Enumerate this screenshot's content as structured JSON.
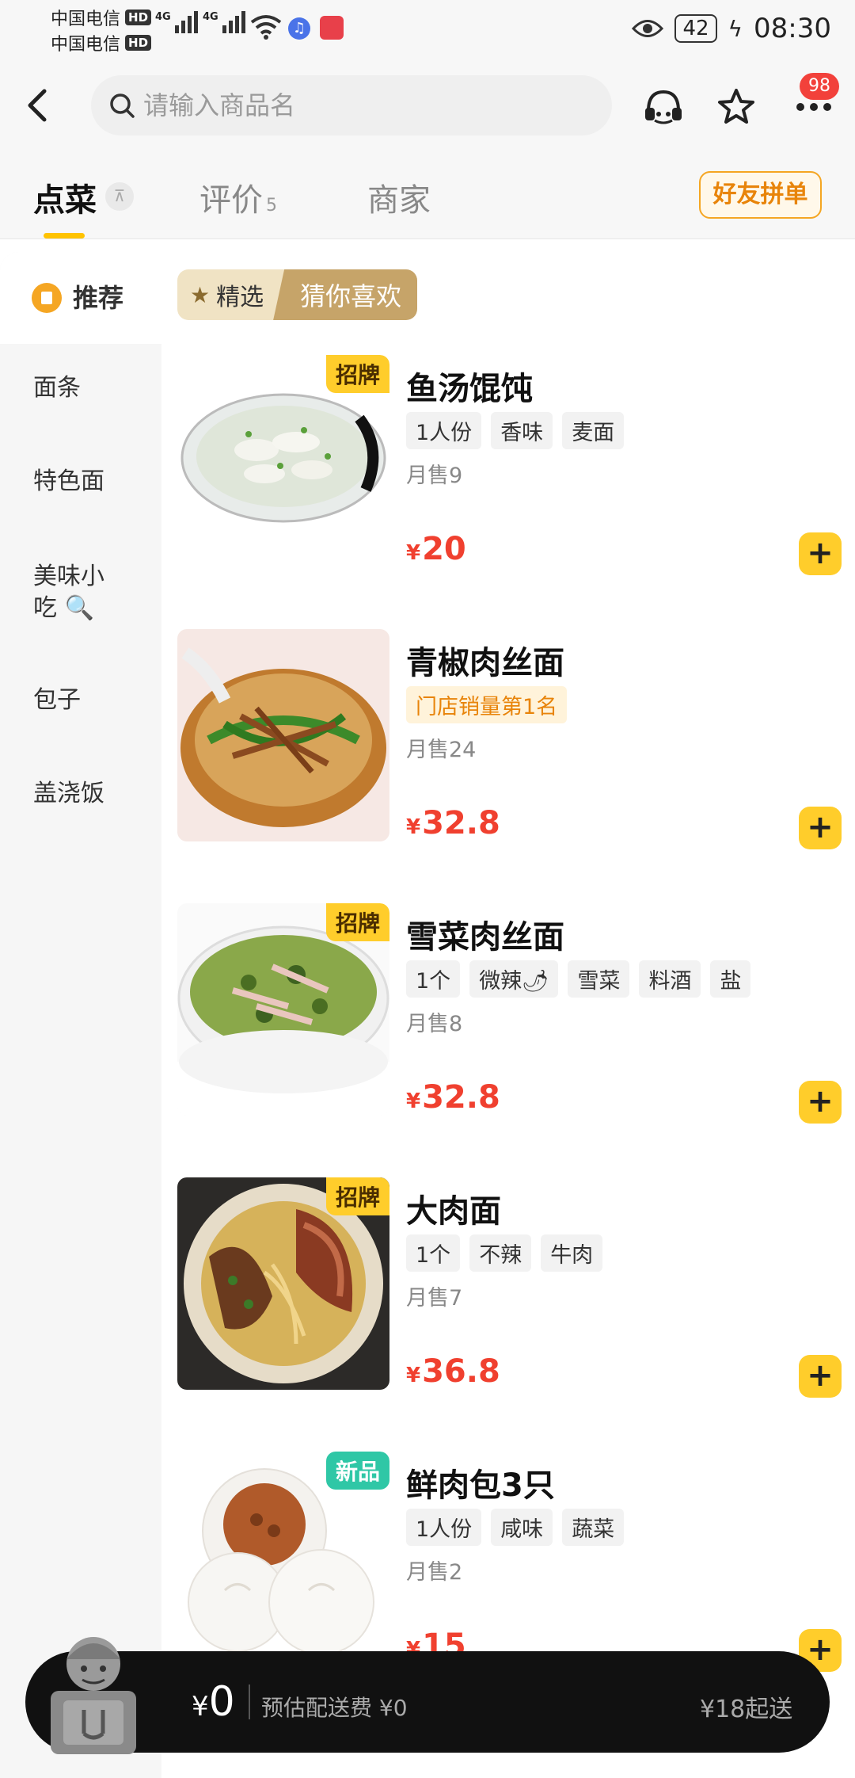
{
  "status": {
    "carrier1": "中国电信",
    "carrier2": "中国电信",
    "hd": "HD",
    "net": "4G",
    "battery": "42",
    "time": "08:30"
  },
  "header": {
    "search_placeholder": "请输入商品名",
    "cart_badge": "98"
  },
  "tabs": {
    "order": "点菜",
    "reviews": "评价",
    "reviews_count": "5",
    "merchant": "商家",
    "group_order": "好友拼单"
  },
  "sidebar": {
    "items": [
      {
        "label": "推荐"
      },
      {
        "label": "面条"
      },
      {
        "label": "特色面"
      },
      {
        "label": "美味小吃"
      },
      {
        "label": "包子"
      },
      {
        "label": "盖浇饭"
      }
    ]
  },
  "filters": {
    "featured": "精选",
    "guess": "猜你喜欢"
  },
  "dishes": [
    {
      "name": "鱼汤馄饨",
      "tag": "招牌",
      "chips": [
        "1人份",
        "香味",
        "麦面"
      ],
      "sales": "月售9",
      "currency": "¥",
      "price": "20"
    },
    {
      "name": "青椒肉丝面",
      "rank": "门店销量第1名",
      "sales": "月售24",
      "currency": "¥",
      "price": "32.8"
    },
    {
      "name": "雪菜肉丝面",
      "tag": "招牌",
      "chips": [
        "1个",
        "微辣🌶",
        "雪菜",
        "料酒",
        "盐"
      ],
      "sales": "月售8",
      "currency": "¥",
      "price": "32.8"
    },
    {
      "name": "大肉面",
      "tag": "招牌",
      "chips": [
        "1个",
        "不辣",
        "牛肉"
      ],
      "sales": "月售7",
      "currency": "¥",
      "price": "36.8"
    },
    {
      "name": "鲜肉包3只",
      "tag": "新品",
      "chips": [
        "1人份",
        "咸味",
        "蔬菜"
      ],
      "sales": "月售2",
      "currency": "¥",
      "price": "15"
    }
  ],
  "add_label": "+",
  "cart": {
    "currency": "¥",
    "total": "0",
    "delivery_fee": "预估配送费 ¥0",
    "min_order": "¥18起送"
  },
  "colors": {
    "accent_yellow": "#ffcd2b",
    "price_red": "#f0402f",
    "rank_orange": "#e8840a",
    "new_green": "#2fc7a6"
  }
}
